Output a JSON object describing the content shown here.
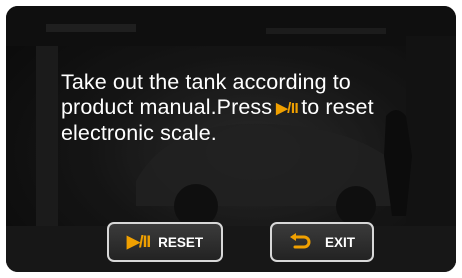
{
  "message": {
    "line1": "Take out the tank according to",
    "line2_before": "product manual.Press",
    "line2_icon": "▶/II",
    "line2_after": "to reset",
    "line3": "electronic scale."
  },
  "buttons": {
    "reset": {
      "icon": "play-pause-icon",
      "icon_glyph": "▶/II",
      "label": "RESET"
    },
    "exit": {
      "icon": "return-arrow-icon",
      "label": "EXIT"
    }
  },
  "colors": {
    "accent": "#f0a000",
    "text": "#ffffff",
    "button_border": "#d8d8d8",
    "background": "#1a1a1a"
  }
}
